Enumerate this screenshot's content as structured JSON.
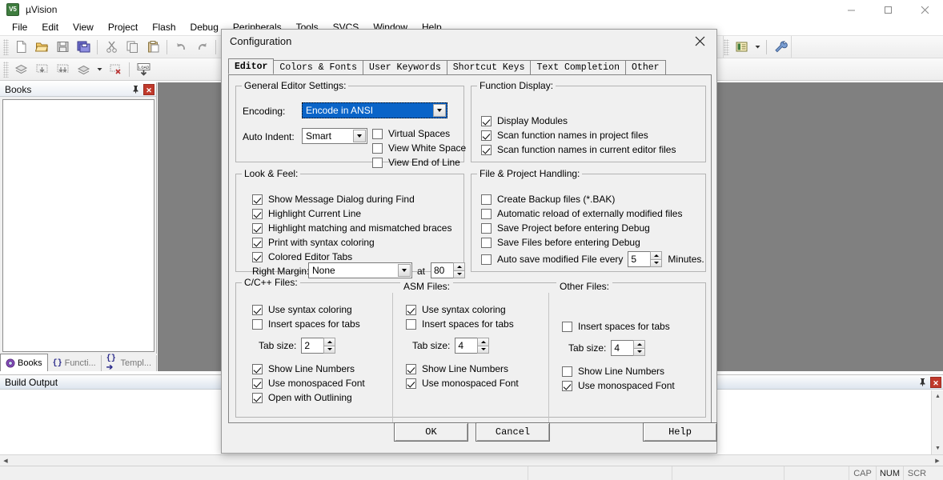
{
  "window": {
    "title": "µVision",
    "app_icon": "uvision-logo-icon",
    "minimize_label": "─",
    "maximize_label": "☐",
    "close_label": "✕"
  },
  "menubar": {
    "items": [
      {
        "label": "File"
      },
      {
        "label": "Edit"
      },
      {
        "label": "View"
      },
      {
        "label": "Project"
      },
      {
        "label": "Flash"
      },
      {
        "label": "Debug"
      },
      {
        "label": "Peripherals"
      },
      {
        "label": "Tools"
      },
      {
        "label": "SVCS"
      },
      {
        "label": "Window"
      },
      {
        "label": "Help"
      }
    ]
  },
  "toolbar": {
    "row1": [
      {
        "name": "new-file-icon"
      },
      {
        "name": "open-file-icon"
      },
      {
        "name": "save-icon"
      },
      {
        "name": "save-all-icon"
      },
      {
        "name": "cut-icon"
      },
      {
        "name": "copy-icon"
      },
      {
        "name": "paste-icon"
      },
      {
        "name": "undo-icon"
      },
      {
        "name": "redo-icon"
      },
      {
        "name": "navigate-back-icon"
      }
    ],
    "row2": [
      {
        "name": "translate-icon"
      },
      {
        "name": "build-icon"
      },
      {
        "name": "rebuild-icon"
      },
      {
        "name": "batch-build-icon"
      },
      {
        "name": "stop-build-icon"
      },
      {
        "name": "load-icon"
      }
    ],
    "right": [
      {
        "name": "target-options-icon"
      },
      {
        "name": "configuration-wrench-icon"
      }
    ]
  },
  "books_panel": {
    "title": "Books",
    "pin_icon": "pin-icon",
    "close_icon": "close-icon",
    "tabs": [
      {
        "label": "Books",
        "icon": "books-icon",
        "active": true
      },
      {
        "label": "Functi...",
        "icon": "{}",
        "active": false
      },
      {
        "label": "Templ...",
        "icon": "{}➔",
        "active": false
      }
    ]
  },
  "build_output": {
    "title": "Build Output",
    "pin_icon": "pin-icon",
    "close_icon": "close-icon"
  },
  "statusbar": {
    "indicators": [
      {
        "label": "CAP",
        "active": false
      },
      {
        "label": "NUM",
        "active": true
      },
      {
        "label": "SCR",
        "active": false
      }
    ]
  },
  "dialog": {
    "title": "Configuration",
    "close_icon": "close-icon",
    "tabs": [
      {
        "label": "Editor",
        "active": true
      },
      {
        "label": "Colors & Fonts",
        "active": false
      },
      {
        "label": "User Keywords",
        "active": false
      },
      {
        "label": "Shortcut Keys",
        "active": false
      },
      {
        "label": "Text Completion",
        "active": false
      },
      {
        "label": "Other",
        "active": false
      }
    ],
    "general_editor_settings": {
      "legend": "General Editor Settings:",
      "encoding_label": "Encoding:",
      "encoding_value": "Encode in ANSI",
      "auto_indent_label": "Auto Indent:",
      "auto_indent_value": "Smart",
      "checkboxes": [
        {
          "label": "Virtual Spaces",
          "checked": false
        },
        {
          "label": "View White Space",
          "checked": false
        },
        {
          "label": "View End of Line",
          "checked": false
        }
      ]
    },
    "function_display": {
      "legend": "Function Display:",
      "checkboxes": [
        {
          "label": "Display Modules",
          "checked": true
        },
        {
          "label": "Scan function names in project files",
          "checked": true
        },
        {
          "label": "Scan function names in current editor files",
          "checked": true
        }
      ]
    },
    "look_and_feel": {
      "legend": "Look & Feel:",
      "checkboxes": [
        {
          "label": "Show Message Dialog during Find",
          "checked": true
        },
        {
          "label": "Highlight Current Line",
          "checked": true
        },
        {
          "label": "Highlight matching and mismatched braces",
          "checked": true
        },
        {
          "label": "Print with syntax coloring",
          "checked": true
        },
        {
          "label": "Colored Editor Tabs",
          "checked": true
        }
      ],
      "right_margin_label": "Right Margin:",
      "right_margin_value": "None",
      "at_label": "at",
      "right_margin_column": "80"
    },
    "file_project_handling": {
      "legend": "File & Project Handling:",
      "checkboxes": [
        {
          "label": "Create Backup files (*.BAK)",
          "checked": false
        },
        {
          "label": "Automatic reload of externally modified files",
          "checked": false
        },
        {
          "label": "Save Project before entering Debug",
          "checked": false
        },
        {
          "label": "Save Files before entering Debug",
          "checked": false
        }
      ],
      "autosave_label": "Auto save modified File every",
      "autosave_checked": false,
      "autosave_value": "5",
      "autosave_unit": "Minutes."
    },
    "c_cpp_files": {
      "legend": "C/C++ Files:",
      "use_syntax_coloring": {
        "label": "Use syntax coloring",
        "checked": true
      },
      "insert_spaces": {
        "label": "Insert spaces for tabs",
        "checked": false
      },
      "tab_size_label": "Tab size:",
      "tab_size_value": "2",
      "show_line_numbers": {
        "label": "Show Line Numbers",
        "checked": true
      },
      "use_monospaced": {
        "label": "Use monospaced Font",
        "checked": true
      },
      "open_with_outlining": {
        "label": "Open with Outlining",
        "checked": true
      }
    },
    "asm_files": {
      "legend": "ASM Files:",
      "use_syntax_coloring": {
        "label": "Use syntax coloring",
        "checked": true
      },
      "insert_spaces": {
        "label": "Insert spaces for tabs",
        "checked": false
      },
      "tab_size_label": "Tab size:",
      "tab_size_value": "4",
      "show_line_numbers": {
        "label": "Show Line Numbers",
        "checked": true
      },
      "use_monospaced": {
        "label": "Use monospaced Font",
        "checked": true
      }
    },
    "other_files": {
      "legend": "Other Files:",
      "insert_spaces": {
        "label": "Insert spaces for tabs",
        "checked": false
      },
      "tab_size_label": "Tab size:",
      "tab_size_value": "4",
      "show_line_numbers": {
        "label": "Show Line Numbers",
        "checked": false
      },
      "use_monospaced": {
        "label": "Use monospaced Font",
        "checked": true
      }
    },
    "buttons": {
      "ok": "OK",
      "cancel": "Cancel",
      "help": "Help"
    }
  },
  "colors": {
    "accent_selection": "#0a64c8",
    "close_red": "#c0392b",
    "dialog_bg": "#f0f0f0",
    "editor_bg": "#808080"
  }
}
